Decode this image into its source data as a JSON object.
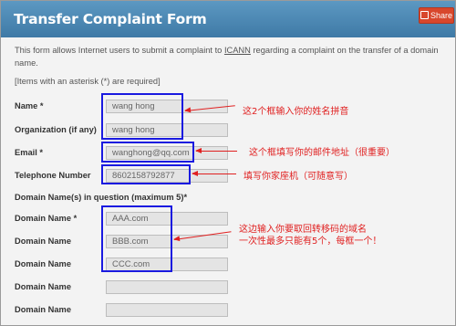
{
  "header": {
    "title": "Transfer Complaint Form",
    "share_label": "Share"
  },
  "intro": {
    "text_before": "This form allows Internet users to submit a complaint to ",
    "link": "ICANN",
    "text_after": " regarding a complaint on the transfer of a domain name.",
    "required": "[Items with an asterisk (*) are required]"
  },
  "fields": {
    "name": {
      "label": "Name *",
      "value": "wang hong"
    },
    "organization": {
      "label": "Organization (if any)",
      "value": "wang hong"
    },
    "email": {
      "label": "Email *",
      "value": "wanghong@qq.com"
    },
    "telephone": {
      "label": "Telephone Number",
      "value": "8602158792877"
    }
  },
  "domains": {
    "section_label": "Domain Name(s) in question (maximum 5)*",
    "items": [
      {
        "label": "Domain Name *",
        "value": "AAA.com"
      },
      {
        "label": "Domain Name",
        "value": "BBB.com"
      },
      {
        "label": "Domain Name",
        "value": "CCC.com"
      },
      {
        "label": "Domain Name",
        "value": ""
      },
      {
        "label": "Domain Name",
        "value": ""
      }
    ]
  },
  "annotations": {
    "name_note": "这2个框输入你的姓名拼音",
    "email_note": "这个框填写你的邮件地址（很重要）",
    "phone_note": "填写你家座机（可随意写）",
    "domain_note_line1": "这边输入你要取回转移码的域名",
    "domain_note_line2": "一次性最多只能有5个，每框一个！",
    "color": "#e02020",
    "highlight_color": "#1a1ae0"
  },
  "colors": {
    "header": "#4a86b4",
    "share_button": "#d8472c"
  }
}
